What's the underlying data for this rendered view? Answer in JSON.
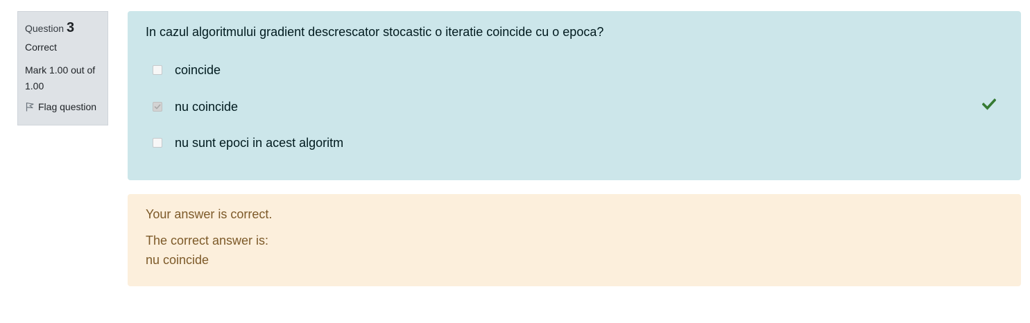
{
  "info": {
    "question_label": "Question",
    "question_number": "3",
    "state": "Correct",
    "grade": "Mark 1.00 out of 1.00",
    "flag_label": "Flag question"
  },
  "question": {
    "text": "In cazul algoritmului gradient descrescator stocastic o iteratie coincide cu o epoca?",
    "answers": [
      {
        "label": "coincide",
        "checked": false
      },
      {
        "label": "nu coincide",
        "checked": true,
        "marked_correct": true
      },
      {
        "label": "nu sunt epoci in acest algoritm",
        "checked": false
      }
    ],
    "icons": {
      "correct": "check-icon",
      "flag": "flag-icon"
    },
    "colors": {
      "formulation_bg": "#cce6ea",
      "feedback_bg": "#fcefdc",
      "check": "#357a32"
    }
  },
  "feedback": {
    "general": "Your answer is correct.",
    "right_answer_intro": "The correct answer is:",
    "right_answer": "nu coincide"
  }
}
